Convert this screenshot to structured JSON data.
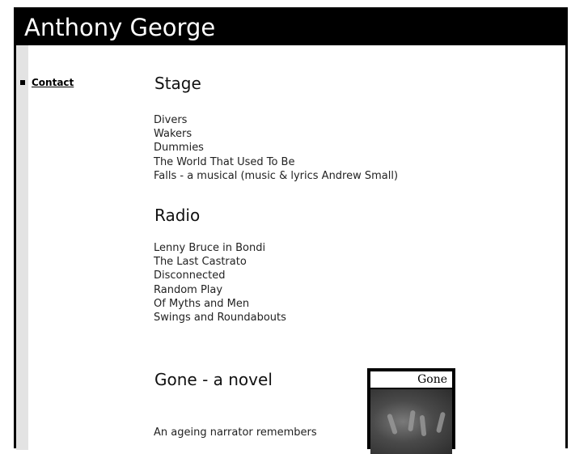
{
  "header": {
    "title": "Anthony George"
  },
  "sidebar": {
    "items": [
      {
        "label": "Contact"
      }
    ]
  },
  "sections": {
    "stage": {
      "heading": "Stage",
      "items": [
        "Divers",
        "Wakers",
        "Dummies",
        "The World That Used To Be",
        "Falls - a musical (music & lyrics Andrew Small)"
      ]
    },
    "radio": {
      "heading": "Radio",
      "items": [
        "Lenny Bruce in Bondi",
        "The Last Castrato",
        "Disconnected",
        "Random Play",
        "Of Myths and Men",
        "Swings and Roundabouts"
      ]
    },
    "novel": {
      "heading": "Gone - a novel",
      "description": "An ageing narrator remembers",
      "cover_title": "Gone"
    }
  }
}
